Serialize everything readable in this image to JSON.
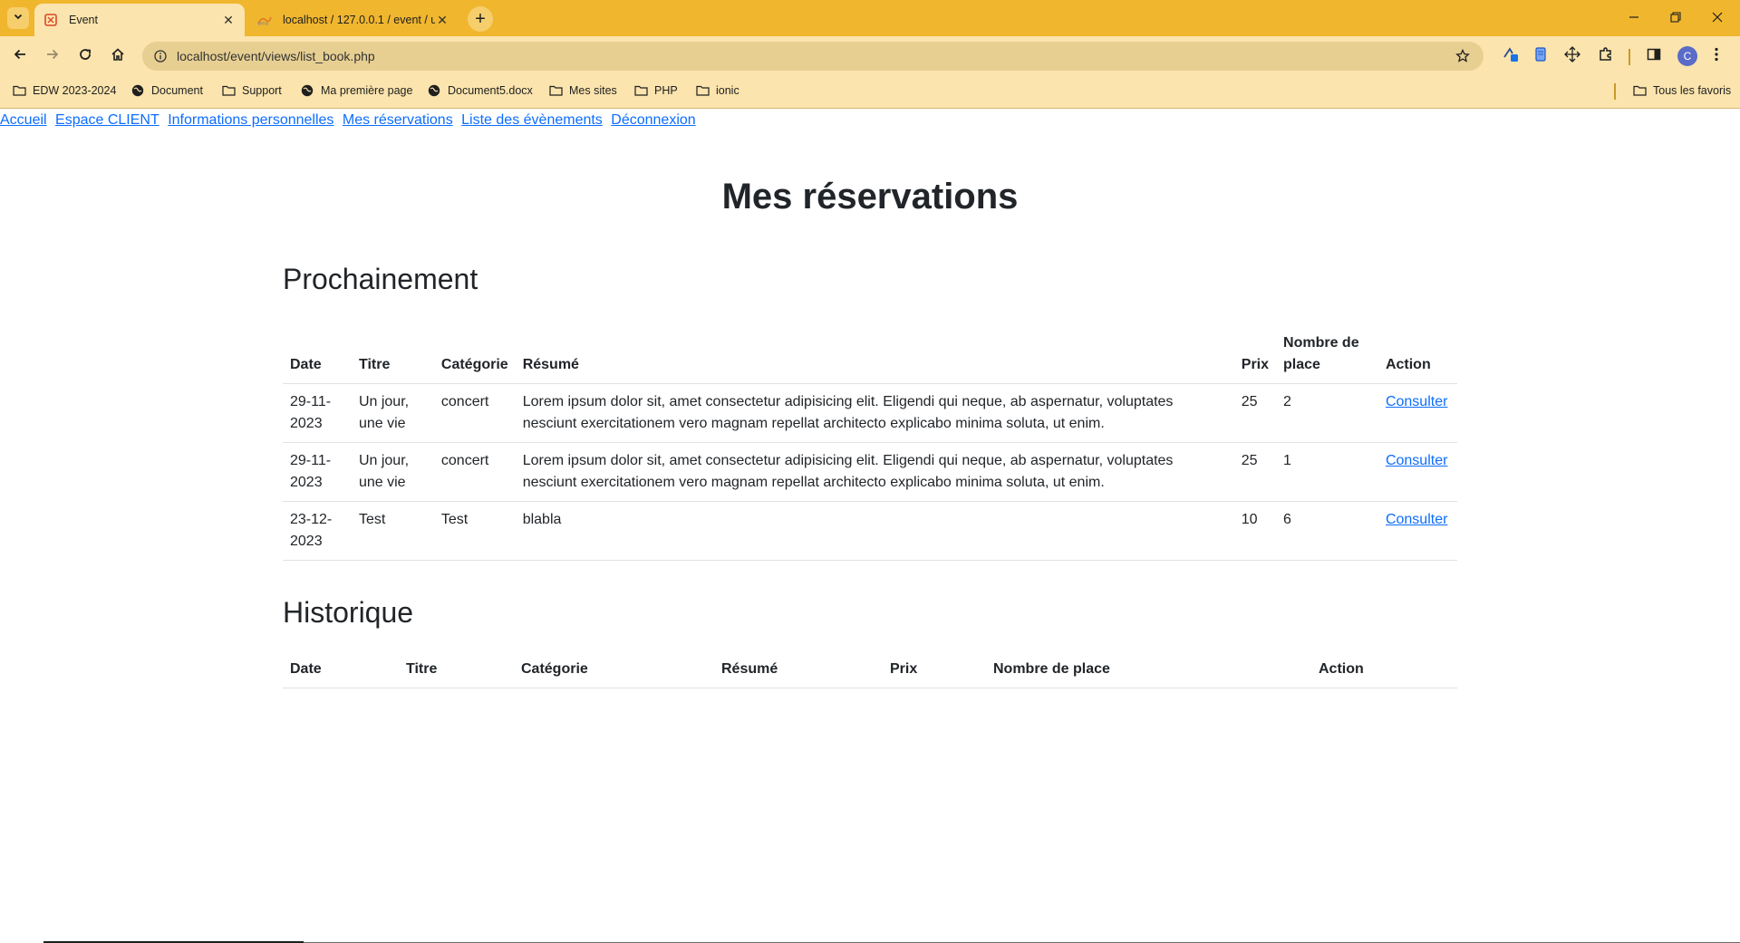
{
  "browser": {
    "tabs": [
      {
        "title": "Event",
        "active": true
      },
      {
        "title": "localhost / 127.0.0.1 / event / u",
        "active": false
      }
    ],
    "url": "localhost/event/views/list_book.php",
    "profile_initial": "C",
    "bookmarks": [
      {
        "label": "EDW 2023-2024",
        "icon": "folder-icon"
      },
      {
        "label": "Document",
        "icon": "globe-icon"
      },
      {
        "label": "Support",
        "icon": "folder-icon"
      },
      {
        "label": "Ma première page",
        "icon": "globe-icon"
      },
      {
        "label": "Document5.docx",
        "icon": "globe-icon"
      },
      {
        "label": "Mes sites",
        "icon": "folder-icon"
      },
      {
        "label": "PHP",
        "icon": "folder-icon"
      },
      {
        "label": "ionic",
        "icon": "folder-icon"
      }
    ],
    "all_bookmarks": "Tous les favoris",
    "theme_color": "#f0b62e"
  },
  "nav": {
    "links": [
      "Accueil",
      "Espace CLIENT",
      "Informations personnelles",
      "Mes réservations",
      "Liste des évènements",
      "Déconnexion"
    ]
  },
  "page": {
    "title": "Mes réservations",
    "upcoming": {
      "heading": "Prochainement",
      "columns": [
        "Date",
        "Titre",
        "Catégorie",
        "Résumé",
        "Prix",
        "Nombre de place",
        "Action"
      ],
      "rows": [
        {
          "date": "29-11-2023",
          "title": "Un jour, une vie",
          "category": "concert",
          "summary": "Lorem ipsum dolor sit, amet consectetur adipisicing elit. Eligendi qui neque, ab aspernatur, voluptates nesciunt exercitationem vero magnam repellat architecto explicabo minima soluta, ut enim.",
          "price": "25",
          "places": "2",
          "action": "Consulter"
        },
        {
          "date": "29-11-2023",
          "title": "Un jour, une vie",
          "category": "concert",
          "summary": "Lorem ipsum dolor sit, amet consectetur adipisicing elit. Eligendi qui neque, ab aspernatur, voluptates nesciunt exercitationem vero magnam repellat architecto explicabo minima soluta, ut enim.",
          "price": "25",
          "places": "1",
          "action": "Consulter"
        },
        {
          "date": "23-12-2023",
          "title": "Test",
          "category": "Test",
          "summary": "blabla",
          "price": "10",
          "places": "6",
          "action": "Consulter"
        }
      ]
    },
    "history": {
      "heading": "Historique",
      "columns": [
        "Date",
        "Titre",
        "Catégorie",
        "Résumé",
        "Prix",
        "Nombre de place",
        "Action"
      ],
      "rows": []
    },
    "link_color": "#0d6efd"
  }
}
